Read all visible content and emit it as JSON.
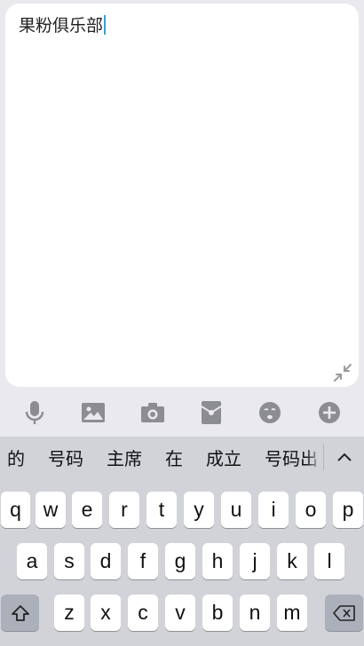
{
  "compose": {
    "text": "果粉俱乐部"
  },
  "toolbar": {
    "items": [
      "microphone-icon",
      "image-icon",
      "camera-icon",
      "red-envelope-icon",
      "emoji-icon",
      "plus-icon"
    ]
  },
  "keyboard": {
    "candidates": [
      "的",
      "号码",
      "主席",
      "在",
      "成立",
      "号码出"
    ],
    "row1": [
      "q",
      "w",
      "e",
      "r",
      "t",
      "y",
      "u",
      "i",
      "o",
      "p"
    ],
    "row2": [
      "a",
      "s",
      "d",
      "f",
      "g",
      "h",
      "j",
      "k",
      "l"
    ],
    "row3": [
      "z",
      "x",
      "c",
      "v",
      "b",
      "n",
      "m"
    ]
  },
  "colors": {
    "caret": "#2aa6d8",
    "keyboard_bg": "#d1d3d9",
    "key_bg": "#ffffff",
    "special_key_bg": "#acb0ba"
  }
}
